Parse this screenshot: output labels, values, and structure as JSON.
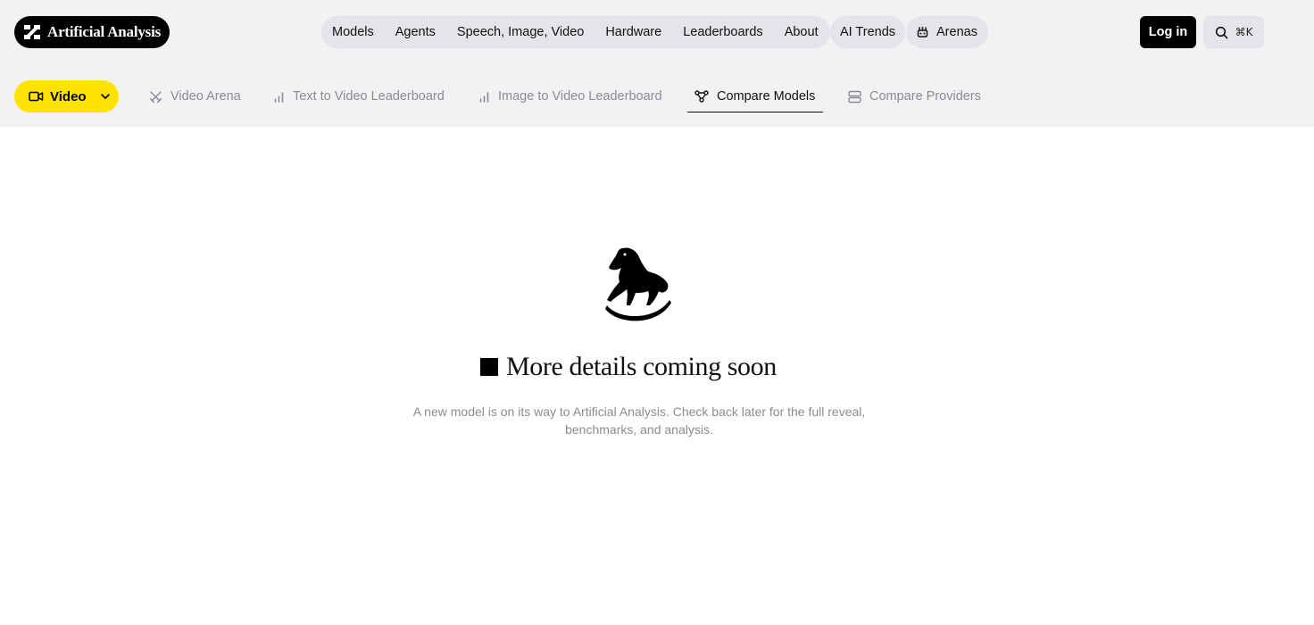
{
  "brand": {
    "name": "Artificial Analysis",
    "logo_icon": "aa-logo-icon"
  },
  "nav": {
    "items": [
      "Models",
      "Agents",
      "Speech, Image, Video",
      "Hardware",
      "Leaderboards",
      "About"
    ],
    "trends": "AI Trends",
    "arenas": {
      "label": "Arenas",
      "icon": "arena-icon"
    }
  },
  "actions": {
    "login": "Log in",
    "search_shortcut": "⌘K",
    "search_icon": "search-icon"
  },
  "section": {
    "label": "Video",
    "icon": "video-camera-icon",
    "accent": "#ffe200"
  },
  "subtabs": [
    {
      "label": "Video Arena",
      "icon": "swords-icon",
      "active": false
    },
    {
      "label": "Text to Video Leaderboard",
      "icon": "bar-chart-icon",
      "active": false
    },
    {
      "label": "Image to Video Leaderboard",
      "icon": "bar-chart-icon",
      "active": false
    },
    {
      "label": "Compare Models",
      "icon": "compare-nodes-icon",
      "active": true
    },
    {
      "label": "Compare Providers",
      "icon": "server-icon",
      "active": false
    }
  ],
  "content": {
    "illustration": "rocking-horse-icon",
    "headline": "More details coming soon",
    "description_line1": "A new model is on its way to Artificial Analysis. Check back later for the full reveal,",
    "description_line2": "benchmarks, and analysis."
  }
}
